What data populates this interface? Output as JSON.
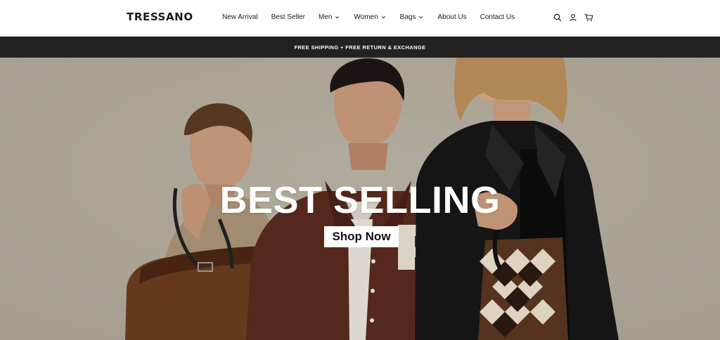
{
  "brand": {
    "name": "TRESSANO"
  },
  "nav": {
    "items": [
      {
        "label": "New Arrival",
        "has_dropdown": false
      },
      {
        "label": "Best Seller",
        "has_dropdown": false
      },
      {
        "label": "Men",
        "has_dropdown": true
      },
      {
        "label": "Women",
        "has_dropdown": true
      },
      {
        "label": "Bags",
        "has_dropdown": true
      },
      {
        "label": "About Us",
        "has_dropdown": false
      },
      {
        "label": "Contact Us",
        "has_dropdown": false
      }
    ]
  },
  "header_icons": [
    "search-icon",
    "user-icon",
    "cart-icon"
  ],
  "announcement": {
    "text": "FREE SHIPPING + FREE RETURN & EXCHANGE"
  },
  "hero": {
    "title": "BEST SELLING",
    "button_label": "Shop Now"
  },
  "colors": {
    "announcement_bg": "#222222",
    "hero_bg": "#b2ab9d",
    "text": "#1a1a1a",
    "white": "#ffffff"
  }
}
